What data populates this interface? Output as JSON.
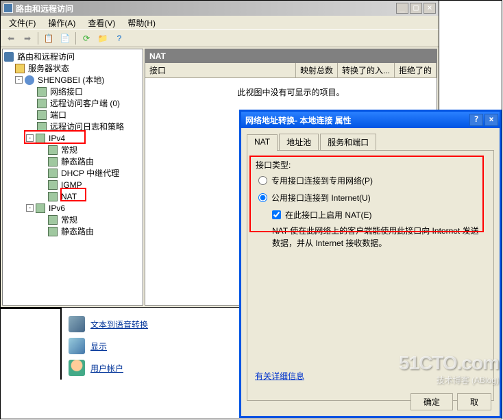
{
  "main_window": {
    "title": "路由和远程访问",
    "menus": [
      "文件(F)",
      "操作(A)",
      "查看(V)",
      "帮助(H)"
    ]
  },
  "tree": {
    "root": "路由和远程访问",
    "server_status": "服务器状态",
    "server": "SHENGBEI (本地)",
    "items": {
      "net_interface": "网络接口",
      "remote_client": "远程访问客户端 (0)",
      "ports": "端口",
      "remote_log": "远程访问日志和策略",
      "ipv4": "IPv4",
      "ipv4_items": {
        "general": "常规",
        "static_route": "静态路由",
        "dhcp_relay": "DHCP 中继代理",
        "igmp": "IGMP",
        "nat": "NAT"
      },
      "ipv6": "IPv6",
      "ipv6_items": {
        "general": "常规",
        "static_route": "静态路由"
      }
    }
  },
  "right_panel": {
    "header": "NAT",
    "columns": [
      "接口",
      "映射总数",
      "转换了的入...",
      "拒绝了的"
    ],
    "empty_message": "此视图中没有可显示的项目。"
  },
  "bottom_items": {
    "tts": "文本到语音转换",
    "display": "显示",
    "user": "用户帐户"
  },
  "dialog": {
    "title": "网络地址转换- 本地连接 属性",
    "tabs": [
      "NAT",
      "地址池",
      "服务和端口"
    ],
    "interface_type_label": "接口类型:",
    "radio_private": "专用接口连接到专用网络(P)",
    "radio_public": "公用接口连接到 Internet(U)",
    "checkbox_nat": "在此接口上启用 NAT(E)",
    "nat_desc": "NAT 使在此网络上的客户端能使用此接口向 Internet 发送数据，并从 Internet 接收数据。",
    "link": "有关详细信息",
    "ok": "确定",
    "cancel": "取"
  },
  "watermark": {
    "main": "51CTO.com",
    "sub": "技术博客",
    "suffix": "(ABlog)"
  }
}
